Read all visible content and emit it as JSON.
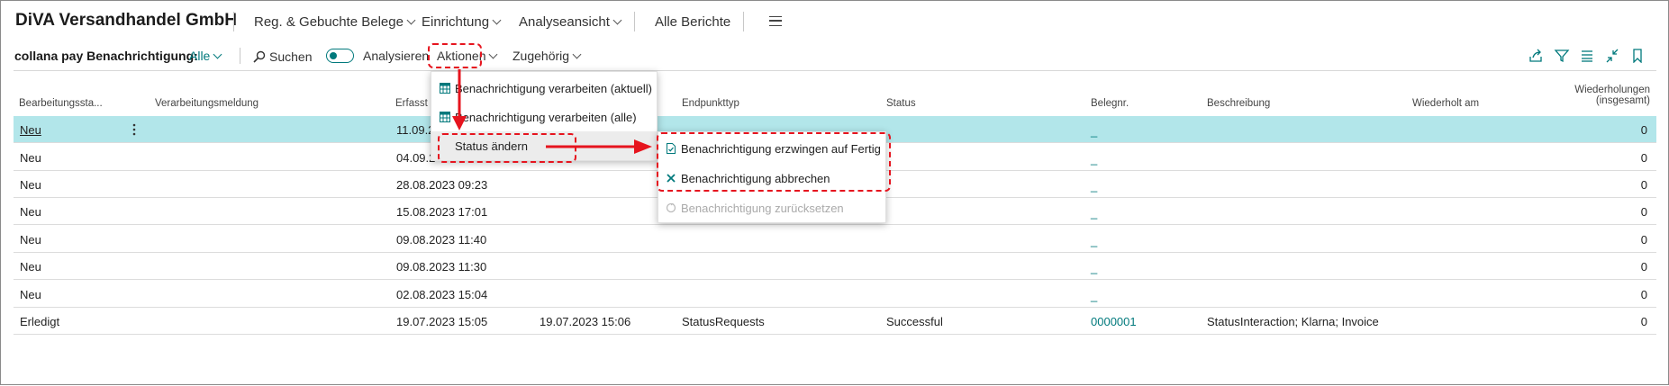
{
  "app": {
    "company": "DiVA Versandhandel GmbH"
  },
  "nav": {
    "items": [
      {
        "label": "Reg. & Gebuchte Belege"
      },
      {
        "label": "Einrichtung"
      },
      {
        "label": "Analyseansicht"
      },
      {
        "label": "Alle Berichte"
      }
    ]
  },
  "actionbar": {
    "page_caption": "collana pay Benachrichtigung:",
    "filter_value": "Alle",
    "search_label": "Suchen",
    "analyze_label": "Analysieren",
    "actions_label": "Aktionen",
    "related_label": "Zugehörig",
    "right_icons": [
      "share-icon",
      "filter-icon",
      "list-view-icon",
      "collapse-icon",
      "bookmark-icon"
    ]
  },
  "table": {
    "headers": {
      "status": "Bearbeitungssta...",
      "message": "Verarbeitungsmeldung",
      "created": "Erfasst am",
      "processed": "",
      "endpoint": "Endpunkttyp",
      "state": "Status",
      "doc_no": "Belegnr.",
      "description": "Beschreibung",
      "repeated": "Wiederholt am",
      "repeats_line1": "Wiederholungen",
      "repeats_line2": "(insgesamt)"
    },
    "rows": [
      {
        "status": "Neu",
        "created": "11.09.2",
        "processed": "",
        "endpoint": "",
        "state": "",
        "doc_no": "_",
        "description": "",
        "repeated": "",
        "repeats": "0",
        "selected": true
      },
      {
        "status": "Neu",
        "created": "04.09.2",
        "processed": "",
        "endpoint": "",
        "state": "",
        "doc_no": "_",
        "description": "",
        "repeated": "",
        "repeats": "0"
      },
      {
        "status": "Neu",
        "created": "28.08.2023 09:23",
        "processed": "",
        "endpoint": "",
        "state": "",
        "doc_no": "_",
        "description": "",
        "repeated": "",
        "repeats": "0"
      },
      {
        "status": "Neu",
        "created": "15.08.2023 17:01",
        "processed": "",
        "endpoint": "",
        "state": "",
        "doc_no": "_",
        "description": "",
        "repeated": "",
        "repeats": "0"
      },
      {
        "status": "Neu",
        "created": "09.08.2023 11:40",
        "processed": "",
        "endpoint": "",
        "state": "",
        "doc_no": "_",
        "description": "",
        "repeated": "",
        "repeats": "0"
      },
      {
        "status": "Neu",
        "created": "09.08.2023 11:30",
        "processed": "",
        "endpoint": "",
        "state": "",
        "doc_no": "_",
        "description": "",
        "repeated": "",
        "repeats": "0"
      },
      {
        "status": "Neu",
        "created": "02.08.2023 15:04",
        "processed": "",
        "endpoint": "",
        "state": "",
        "doc_no": "_",
        "description": "",
        "repeated": "",
        "repeats": "0"
      },
      {
        "status": "Erledigt",
        "created": "19.07.2023 15:05",
        "processed": "19.07.2023 15:06",
        "endpoint": "StatusRequests",
        "state": "Successful",
        "doc_no": "0000001",
        "description": "StatusInteraction;  Klarna; Invoice",
        "repeated": "",
        "repeats": "0"
      }
    ]
  },
  "actions_menu": {
    "items": [
      {
        "label": "Benachrichtigung verarbeiten (aktuell)",
        "icon": "table-grid-icon"
      },
      {
        "label": "Benachrichtigung verarbeiten (alle)",
        "icon": "table-grid-icon"
      },
      {
        "label": "Status ändern",
        "icon": ""
      }
    ]
  },
  "status_submenu": {
    "items": [
      {
        "label": "Benachrichtigung erzwingen auf Fertig",
        "icon": "document-check-icon",
        "enabled": true
      },
      {
        "label": "Benachrichtigung abbrechen",
        "icon": "close-x-icon",
        "enabled": true
      },
      {
        "label": "Benachrichtigung zurücksetzen",
        "icon": "reset-icon",
        "enabled": false
      }
    ]
  },
  "colors": {
    "accent": "#00797c",
    "selected_row": "#b2e6ea",
    "annotation": "#e6141e"
  }
}
